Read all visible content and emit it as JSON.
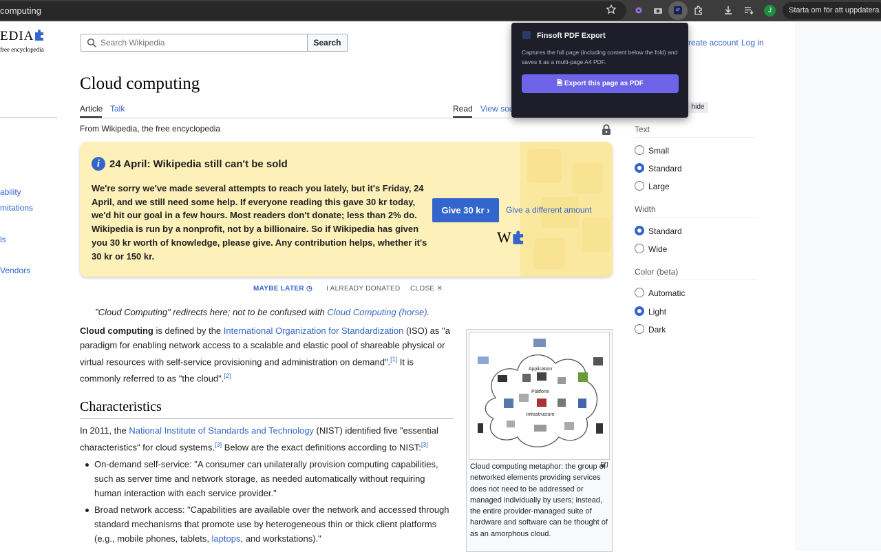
{
  "browser": {
    "url": "computing",
    "update_label": "Starta om för att uppdatera",
    "profile_initial": "J"
  },
  "wiki": {
    "logo_word": "EDIA",
    "logo_sub": "free encyclopedia",
    "search_placeholder": "Search Wikipedia",
    "search_button": "Search",
    "create_account": "reate account",
    "log_in": "Log in"
  },
  "sidebar_links": [
    "ability",
    "mitations",
    "ls",
    "Vendors"
  ],
  "article": {
    "title": "Cloud computing",
    "tab_article": "Article",
    "tab_talk": "Talk",
    "tab_read": "Read",
    "tab_view_source": "View sou",
    "from_wikipedia": "From Wikipedia, the free encyclopedia",
    "hatnote_prefix": "\"Cloud Computing\" redirects here; not to be confused with ",
    "hatnote_link": "Cloud Computing (horse)",
    "hatnote_suffix": ".",
    "intro_bold": "Cloud computing",
    "intro_1": " is defined by the ",
    "intro_link_iso": "International Organization for Standardization",
    "intro_2": " (ISO) as \"a paradigm for enabling network access to a scalable and elastic pool of shareable physical or virtual resources with self-service provisioning and administration on demand\".",
    "ref1": "[1]",
    "intro_3": " It is commonly referred to as \"the cloud\".",
    "ref2": "[2]",
    "h2_characteristics": "Characteristics",
    "char_1": "In 2011, the ",
    "char_link_nist": "National Institute of Standards and Technology",
    "char_2": " (NIST) identified five \"essential characteristics\" for cloud systems.",
    "ref3a": "[3]",
    "char_3": " Below are the exact definitions according to NIST:",
    "ref3b": "[3]",
    "bullet_1": "On-demand self-service: \"A consumer can unilaterally provision computing capabilities, such as server time and network storage, as needed automatically without requiring human interaction with each service provider.\"",
    "bullet_2_a": "Broad network access: \"Capabilities are available over the network and accessed through standard mechanisms that promote use by heterogeneous thin or thick client platforms (e.g., mobile phones, tablets, ",
    "bullet_2_link": "laptops",
    "bullet_2_b": ", and workstations).\"",
    "figure_caption": "Cloud computing metaphor: the group of networked elements providing services does not need to be addressed or managed individually by users; instead, the entire provider-managed suite of hardware and software can be thought of as an amorphous cloud."
  },
  "banner": {
    "title": "24 April: Wikipedia still can't be sold",
    "text": "We're sorry we've made several attempts to reach you lately, but it's Friday, 24 April, and we still need some help. If everyone reading this gave 30 kr today, we'd hit our goal in a few hours. Most readers don't donate; less than 2% do. Wikipedia is run by a nonprofit, not by a billionaire. So if Wikipedia has given you 30 kr worth of knowledge, please give. Any contribution helps, whether it's 30 kr or 150 kr.",
    "give_button": "Give 30 kr",
    "give_different": "Give a different amount",
    "maybe_later": "MAYBE LATER",
    "already_donated": "I ALREADY DONATED",
    "close": "CLOSE"
  },
  "figure_labels": {
    "application": "Application",
    "platform": "Platform",
    "infrastructure": "Infrastructure"
  },
  "appearance": {
    "hide": "hide",
    "text_heading": "Text",
    "text_options": [
      "Small",
      "Standard",
      "Large"
    ],
    "text_selected": 1,
    "width_heading": "Width",
    "width_options": [
      "Standard",
      "Wide"
    ],
    "width_selected": 0,
    "color_heading": "Color (beta)",
    "color_options": [
      "Automatic",
      "Light",
      "Dark"
    ],
    "color_selected": 1
  },
  "popup": {
    "title": "Finsoft PDF Export",
    "description": "Captures the full page (including content below the fold) and saves it as a multi-page A4 PDF.",
    "button": "Export this page as PDF"
  },
  "colors": {
    "link": "#3366cc",
    "popup_button": "#6c63e8",
    "banner_bg": "#fdf0b8"
  }
}
